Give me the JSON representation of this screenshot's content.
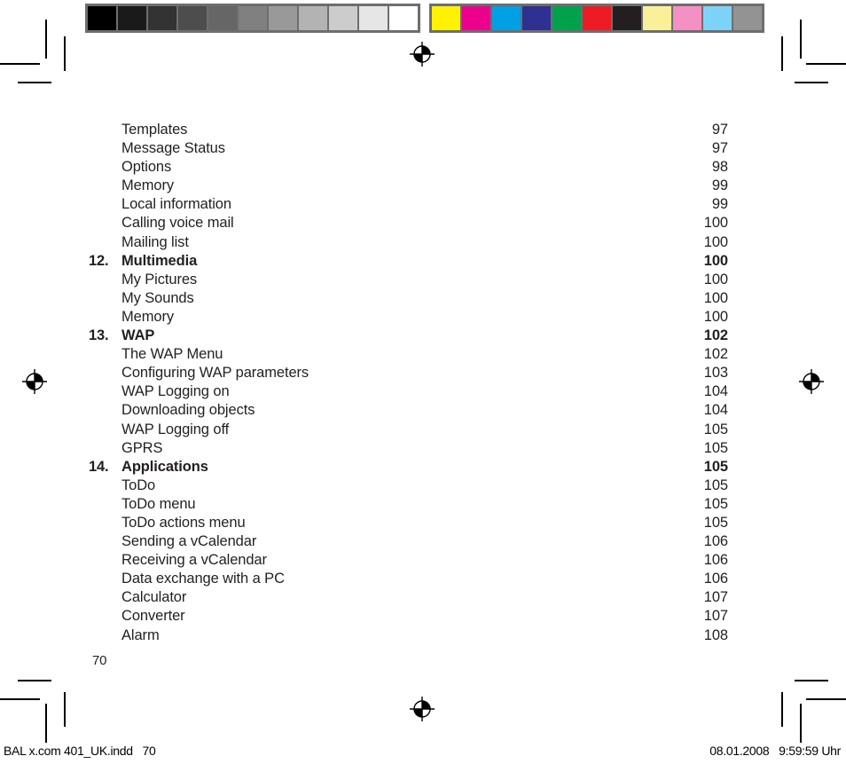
{
  "calibration_bar": {
    "grayscale": [
      "#000000",
      "#1a1a1a",
      "#333333",
      "#4d4d4d",
      "#666666",
      "#808080",
      "#999999",
      "#b3b3b3",
      "#cccccc",
      "#e6e6e6",
      "#ffffff"
    ],
    "colors": [
      "#fff200",
      "#ec008c",
      "#00a0e3",
      "#2e3192",
      "#00a14b",
      "#ed1c24",
      "#231f20",
      "#fbf09a",
      "#f490c4",
      "#7dd3f7",
      "#939393"
    ],
    "frame_color": "#6e6e6e"
  },
  "marks": {
    "registration_icon": "registration-target-icon"
  },
  "toc": {
    "rows": [
      {
        "num": "",
        "label": "Templates",
        "page": "97",
        "chapter": false
      },
      {
        "num": "",
        "label": "Message Status",
        "page": "97",
        "chapter": false
      },
      {
        "num": "",
        "label": "Options",
        "page": "98",
        "chapter": false
      },
      {
        "num": "",
        "label": "Memory",
        "page": "99",
        "chapter": false
      },
      {
        "num": "",
        "label": "Local information",
        "page": "99",
        "chapter": false
      },
      {
        "num": "",
        "label": "Calling voice mail",
        "page": "100",
        "chapter": false
      },
      {
        "num": "",
        "label": "Mailing list",
        "page": "100",
        "chapter": false
      },
      {
        "num": "12.",
        "label": "Multimedia",
        "page": "100",
        "chapter": true
      },
      {
        "num": "",
        "label": "My Pictures",
        "page": "100",
        "chapter": false
      },
      {
        "num": "",
        "label": "My Sounds",
        "page": "100",
        "chapter": false
      },
      {
        "num": "",
        "label": "Memory",
        "page": "100",
        "chapter": false
      },
      {
        "num": "13.",
        "label": "WAP",
        "page": "102",
        "chapter": true
      },
      {
        "num": "",
        "label": "The WAP Menu",
        "page": "102",
        "chapter": false
      },
      {
        "num": "",
        "label": "Configuring WAP parameters",
        "page": "103",
        "chapter": false
      },
      {
        "num": "",
        "label": "WAP Logging on",
        "page": "104",
        "chapter": false
      },
      {
        "num": "",
        "label": "Downloading objects",
        "page": "104",
        "chapter": false
      },
      {
        "num": "",
        "label": "WAP Logging off",
        "page": "105",
        "chapter": false
      },
      {
        "num": "",
        "label": "GPRS",
        "page": "105",
        "chapter": false
      },
      {
        "num": "14.",
        "label": "Applications",
        "page": "105",
        "chapter": true
      },
      {
        "num": "",
        "label": "ToDo",
        "page": "105",
        "chapter": false
      },
      {
        "num": "",
        "label": "ToDo menu",
        "page": "105",
        "chapter": false
      },
      {
        "num": "",
        "label": "ToDo actions menu",
        "page": "105",
        "chapter": false
      },
      {
        "num": "",
        "label": "Sending a vCalendar",
        "page": "106",
        "chapter": false
      },
      {
        "num": "",
        "label": "Receiving a vCalendar",
        "page": "106",
        "chapter": false
      },
      {
        "num": "",
        "label": "Data exchange with a PC",
        "page": "106",
        "chapter": false
      },
      {
        "num": "",
        "label": "Calculator",
        "page": "107",
        "chapter": false
      },
      {
        "num": "",
        "label": "Converter",
        "page": "107",
        "chapter": false
      },
      {
        "num": "",
        "label": "Alarm",
        "page": "108",
        "chapter": false
      }
    ]
  },
  "folio": {
    "page_number": "70"
  },
  "footer": {
    "left": "BAL x.com 401_UK.indd   70",
    "right": "08.01.2008   9:59:59 Uhr"
  }
}
